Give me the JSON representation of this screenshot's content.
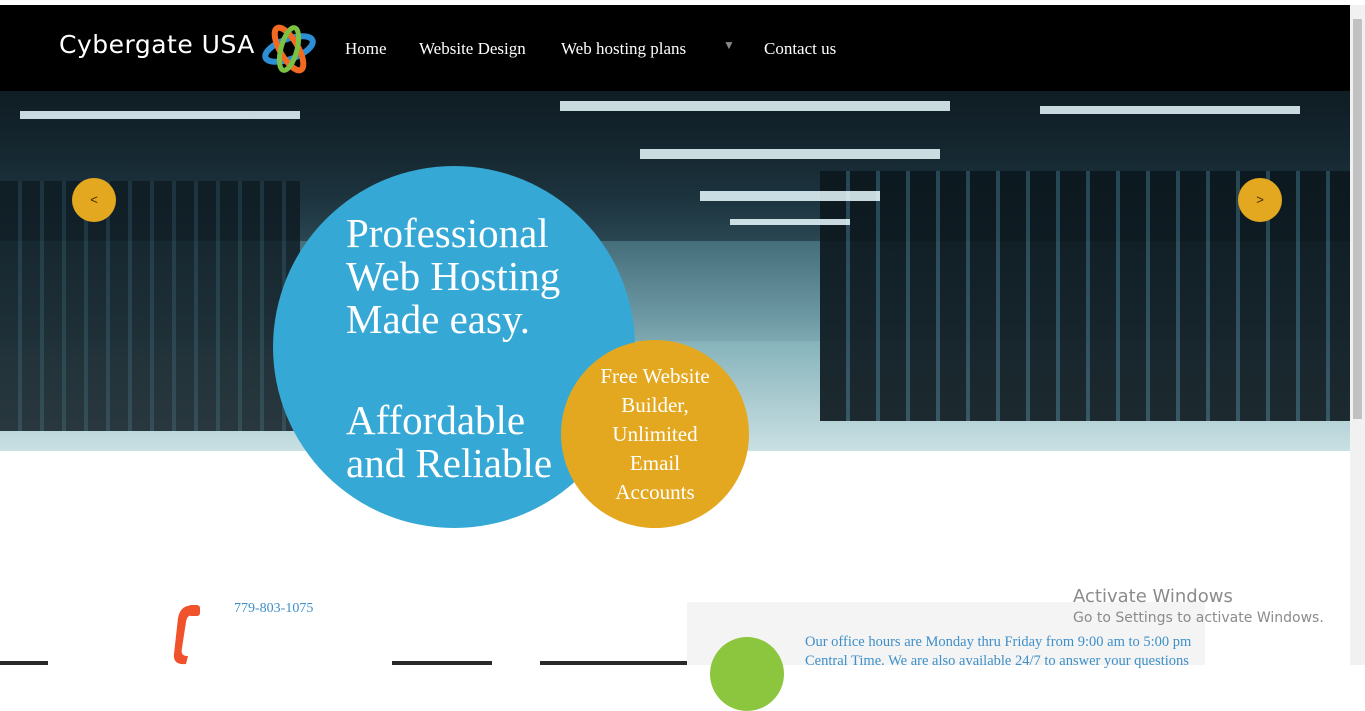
{
  "header": {
    "brand": "Cybergate USA",
    "nav": [
      "Home",
      "Website Design",
      "Web hosting plans",
      "Contact us"
    ],
    "dropdown_icon": "triangle-down-icon"
  },
  "hero": {
    "prev_label": "<",
    "next_label": ">",
    "headline_1": [
      "Professional",
      "Web Hosting",
      "Made easy."
    ],
    "headline_2": [
      "Affordable",
      "and Reliable"
    ],
    "badge": [
      "Free Website",
      "Builder,",
      "Unlimited",
      "Email",
      "Accounts"
    ],
    "colors": {
      "blue": "#36a8d6",
      "gold": "#e3a81f"
    }
  },
  "contact": {
    "phone": "779-803-1075",
    "hours_line_1": "Our office hours are Monday thru Friday from 9:00 am to 5:00 pm",
    "hours_line_2": "Central Time. We are also available 24/7 to answer your questions"
  },
  "watermark": {
    "title": "Activate Windows",
    "subtitle": "Go to Settings to activate Windows."
  }
}
